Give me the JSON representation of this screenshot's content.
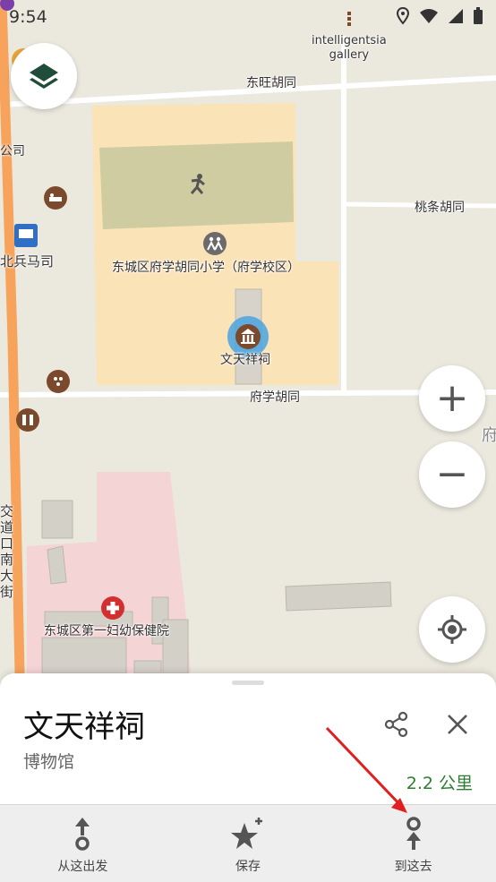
{
  "status_bar": {
    "time": "9:54"
  },
  "map": {
    "poi_labels": {
      "gallery": "intelligentsia\ngallery",
      "road_dongwang": "东旺胡同",
      "road_taotiao": "桃条胡同",
      "road_fuxue": "府学胡同",
      "school": "东城区府学胡同小学（府学校区）",
      "temple": "文天祥祠",
      "bingmasi": "北兵马司",
      "gongsi": "公司",
      "fu": "府",
      "street_vertical": "交道口南大街",
      "hospital": "东城区第一妇幼保健院"
    }
  },
  "controls": {
    "zoom_in": "+",
    "zoom_out": "−"
  },
  "place_card": {
    "title": "文天祥祠",
    "type": "博物馆",
    "distance": "2.2 公里"
  },
  "actions": [
    {
      "label": "从这出发"
    },
    {
      "label": "保存"
    },
    {
      "label": "到这去"
    }
  ],
  "colors": {
    "accent_green": "#2e7d32",
    "arterial_orange": "#f7a35c",
    "school_area": "#fbe3b8",
    "hospital_area": "#f5d4d6",
    "poi_brown": "#7b4a2c",
    "selection_blue": "#4aa3e0"
  }
}
